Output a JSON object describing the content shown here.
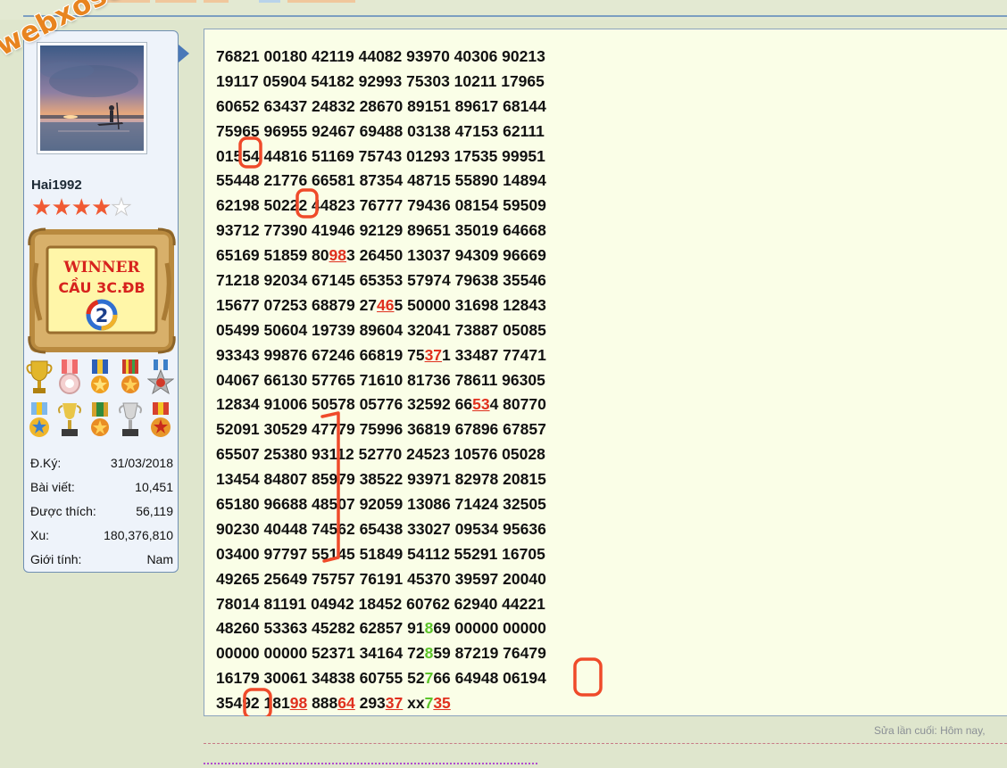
{
  "watermark": {
    "text": "webxoso.net"
  },
  "profile": {
    "username": "Hai1992",
    "rating": {
      "value": 4,
      "max": 5
    },
    "badge": {
      "line1": "WINNER",
      "line2": "CẦU 3C.ĐB",
      "number": "2"
    },
    "stats": [
      {
        "label": "Đ.Ký:",
        "value": "31/03/2018"
      },
      {
        "label": "Bài viết:",
        "value": "10,451"
      },
      {
        "label": "Được thích:",
        "value": "56,119"
      },
      {
        "label": "Xu:",
        "value": "180,376,810"
      },
      {
        "label": "Giới tính:",
        "value": "Nam"
      }
    ]
  },
  "post": {
    "lines": [
      [
        {
          "t": "76821 00180 42119 44082 93970 40306 90213"
        }
      ],
      [
        {
          "t": "19117 05904 54182 92993 75303 10211 17965"
        }
      ],
      [
        {
          "t": "60652 63437 24832 28670 89151 89617 68144"
        }
      ],
      [
        {
          "t": "75965 96955 92467 69488 03138 47153 62111"
        }
      ],
      [
        {
          "t": "01554 44816 51169 75743 01293 17535 99951"
        }
      ],
      [
        {
          "t": "55448 21776 66581 87354 48715 55890 14894"
        }
      ],
      [
        {
          "t": "62198 50222 44823 76777 79436 08154 59509"
        }
      ],
      [
        {
          "t": "93712 77390 41946 92129 89651 35019 64668"
        }
      ],
      [
        {
          "t": "65169 51859 80"
        },
        {
          "t": "98",
          "s": "red"
        },
        {
          "t": "3 26450 13037 94309 96669"
        }
      ],
      [
        {
          "t": "71218 92034 67145 65353 57974 79638 35546"
        }
      ],
      [
        {
          "t": "15677 07253 68879 27"
        },
        {
          "t": "46",
          "s": "red"
        },
        {
          "t": "5 50000 31698 12843"
        }
      ],
      [
        {
          "t": "05499 50604 19739 89604 32041 73887 05085"
        }
      ],
      [
        {
          "t": "93343 99876 67246 66819 75"
        },
        {
          "t": "37",
          "s": "red"
        },
        {
          "t": "1 33487 77471"
        }
      ],
      [
        {
          "t": "04067 66130 57765 71610 81736 78611 96305"
        }
      ],
      [
        {
          "t": "12834 91006 50578 05776 32592 66"
        },
        {
          "t": "53",
          "s": "red"
        },
        {
          "t": "4 80770"
        }
      ],
      [
        {
          "t": "52091 30529 47779 75996 36819 67896 67857"
        }
      ],
      [
        {
          "t": "65507 25380 93112 52770 24523 10576 05028"
        }
      ],
      [
        {
          "t": "13454 84807 85979 38522 93971 82978 20815"
        }
      ],
      [
        {
          "t": "65180 96688 48507 92059 13086 71424 32505"
        }
      ],
      [
        {
          "t": "90230 40448 74562 65438 33027 09534 95636"
        }
      ],
      [
        {
          "t": "03400 97797 55145 51849 54112 55291 16705"
        }
      ],
      [
        {
          "t": "49265 25649 75757 76191 45370 39597 20040"
        }
      ],
      [
        {
          "t": "78014 81191 04942 18452 60762 62940 44221"
        }
      ],
      [
        {
          "t": "48260 53363 45282 62857 91"
        },
        {
          "t": "8",
          "s": "green"
        },
        {
          "t": "69 00000 00000"
        }
      ],
      [
        {
          "t": "00000 00000 52371 34164 72"
        },
        {
          "t": "8",
          "s": "green"
        },
        {
          "t": "59 87219 76479"
        }
      ],
      [
        {
          "t": "16179 30061 34838 60755 52"
        },
        {
          "t": "7",
          "s": "green"
        },
        {
          "t": "66 64948 06194"
        }
      ],
      [
        {
          "t": "35492 181"
        },
        {
          "t": "98",
          "s": "red"
        },
        {
          "t": " 888"
        },
        {
          "t": "64",
          "s": "red"
        },
        {
          "t": " 293"
        },
        {
          "t": "37",
          "s": "red"
        },
        {
          "t": " xx"
        },
        {
          "t": "7",
          "s": "green"
        },
        {
          "t": "35",
          "s": "red"
        }
      ]
    ],
    "edit_note": "Sửa lần cuối: Hôm nay,"
  },
  "colors": {
    "highlight_red": "#e0301e",
    "highlight_green": "#5cc42a",
    "annotation_orange": "#ef4a2a",
    "post_background": "#fafee7",
    "page_background": "#dfe6cd"
  }
}
